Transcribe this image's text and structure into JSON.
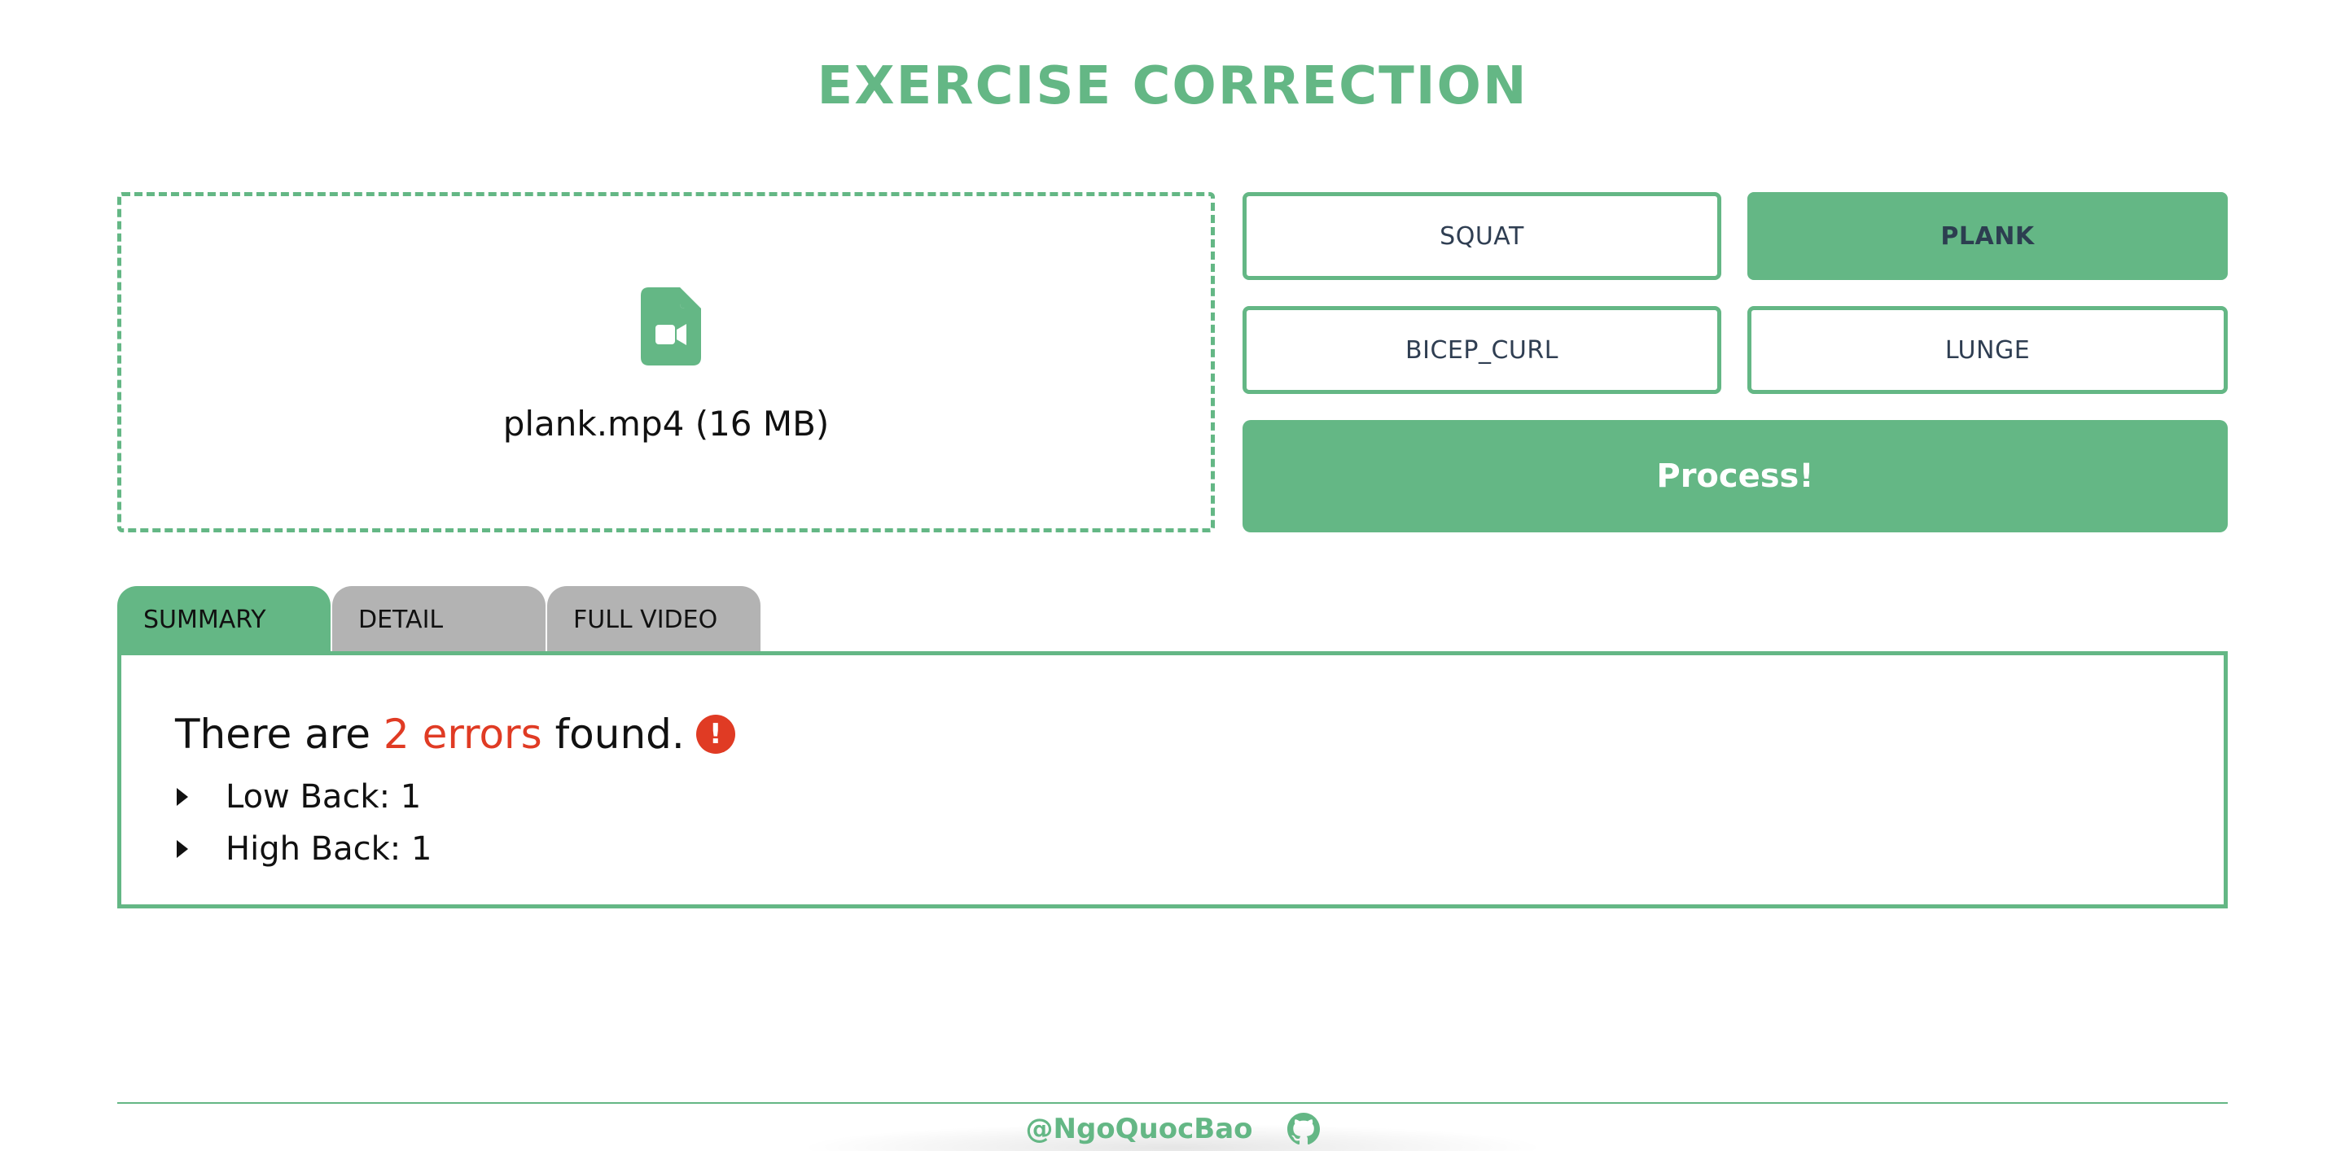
{
  "header": {
    "title": "EXERCISE CORRECTION"
  },
  "upload": {
    "icon": "file-video-icon",
    "file_label": "plank.mp4 (16 MB)"
  },
  "exercises": {
    "items": [
      {
        "label": "SQUAT",
        "selected": false
      },
      {
        "label": "PLANK",
        "selected": true
      },
      {
        "label": "BICEP_CURL",
        "selected": false
      },
      {
        "label": "LUNGE",
        "selected": false
      }
    ]
  },
  "process_button": {
    "label": "Process!"
  },
  "tabs": [
    {
      "label": "SUMMARY",
      "active": true
    },
    {
      "label": "DETAIL",
      "active": false
    },
    {
      "label": "FULL VIDEO",
      "active": false
    }
  ],
  "summary": {
    "prefix": "There are ",
    "error_count_text": "2 errors",
    "suffix": " found.",
    "alert_icon_glyph": "!",
    "errors": [
      {
        "label": "Low Back: 1"
      },
      {
        "label": "High Back: 1"
      }
    ]
  },
  "footer": {
    "author": "@NgoQuocBao",
    "icon": "github-icon"
  },
  "colors": {
    "accent": "#64b785",
    "error": "#e03b24",
    "inactive_tab": "#b3b3b3",
    "button_text": "#2f3e52"
  }
}
